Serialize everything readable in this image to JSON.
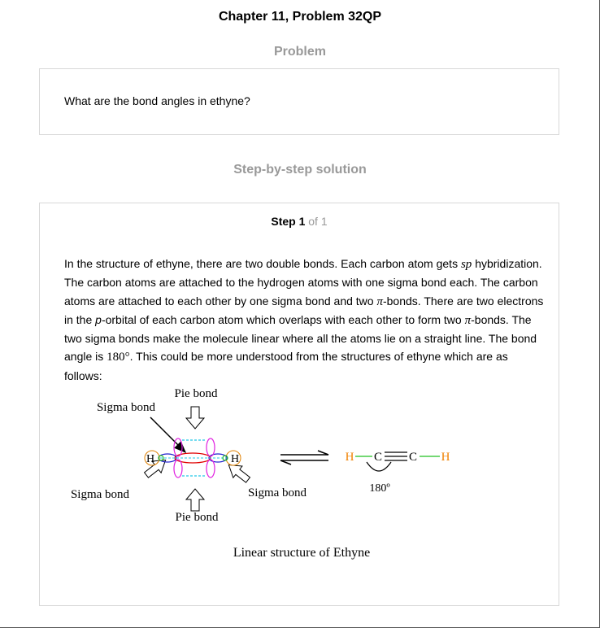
{
  "header": {
    "title": "Chapter 11, Problem 32QP"
  },
  "problem": {
    "heading": "Problem",
    "text": "What are the bond angles in ethyne?"
  },
  "solution": {
    "heading": "Step-by-step solution",
    "step": {
      "label": "Step 1",
      "of": "of 1"
    },
    "paragraph": {
      "t1": "In the structure of ethyne, there are two double bonds. Each carbon atom gets ",
      "sp": "sp",
      "t2": " hybridization. The carbon atoms are attached to the hydrogen atoms with one sigma bond each. The carbon atoms are attached to each other by one sigma bond and two ",
      "pi1": "π",
      "t3": "-bonds. There are two electrons in the ",
      "p": "p",
      "t4": "-orbital of each carbon atom which overlaps with each other to form two ",
      "pi2": "π",
      "t5": "-bonds. The two sigma bonds make the molecule linear where all the atoms lie on a straight line. The bond angle is ",
      "angle": "180°",
      "t6": ". This could be more understood from the structures of ethyne which are as follows:"
    },
    "figure": {
      "pie_bond_top": "Pie bond",
      "sigma_bond_top": "Sigma bond",
      "sigma_bond_left": "Sigma bond",
      "sigma_bond_right": "Sigma bond",
      "pie_bond_bottom": "Pie bond",
      "h_left": "H",
      "h_right": "H",
      "formula_h1": "H",
      "formula_c1": "C",
      "formula_c2": "C",
      "formula_h2": "H",
      "angle_label": "180º",
      "caption": "Linear structure of Ethyne"
    }
  },
  "colors": {
    "heading_gray": "#999999",
    "border": "#d8d8d8",
    "hydrogen_orange": "#f08000",
    "sigma_green": "#22c022",
    "pi_magenta": "#e020e0",
    "sp_red": "#e00000",
    "sp_blue": "#2020d0",
    "pi_cyan": "#22c8e8",
    "h_orbital_orange": "#e08000"
  }
}
